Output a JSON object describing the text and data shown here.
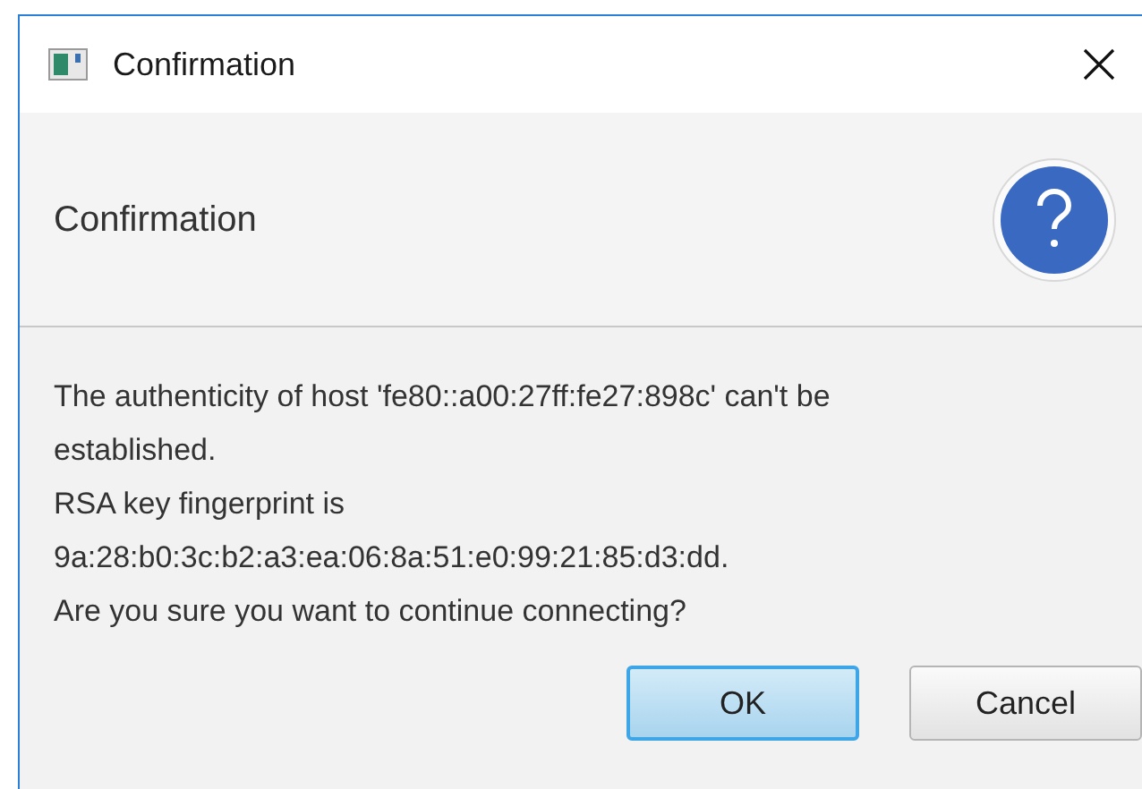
{
  "window": {
    "title": "Confirmation"
  },
  "header": {
    "title": "Confirmation"
  },
  "message": "The authenticity of host 'fe80::a00:27ff:fe27:898c' can't be\nestablished.\nRSA key fingerprint is\n9a:28:b0:3c:b2:a3:ea:06:8a:51:e0:99:21:85:d3:dd.\nAre you sure you want to continue connecting?",
  "buttons": [
    {
      "label": "OK",
      "default": true
    },
    {
      "label": "Cancel",
      "default": false
    }
  ]
}
